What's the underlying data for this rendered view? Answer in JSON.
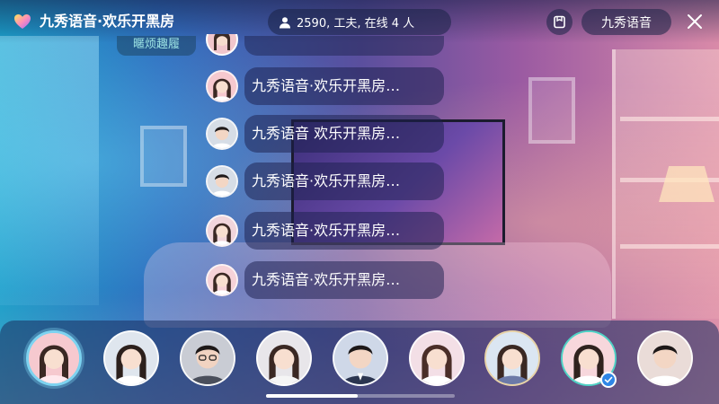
{
  "header": {
    "room_title": "九秀语音·欢乐开黑房",
    "online_text": "2590, 工夫, 在线 4 人",
    "brand_label": "九秀语音",
    "icons": {
      "room": "heart-gradient-icon",
      "user": "user-icon",
      "square": "square-rotate-icon",
      "close": "close-icon"
    }
  },
  "chat": {
    "partial_top_label": "暱烦趣履",
    "messages": [
      {
        "text": "九秀语音·欢乐开黑房…",
        "avatar_kind": "female"
      },
      {
        "text": "九秀语音 欢乐开黑房…",
        "avatar_kind": "male"
      },
      {
        "text": "九秀语音·欢乐开黑房…",
        "avatar_kind": "male"
      },
      {
        "text": "九秀语音·欢乐开黑房…",
        "avatar_kind": "female"
      },
      {
        "text": "九秀语音·欢乐开黑房…",
        "avatar_kind": "female"
      }
    ]
  },
  "seats": [
    {
      "avatar_kind": "female",
      "style": "active",
      "bg": "#f6c9cf"
    },
    {
      "avatar_kind": "female",
      "style": "plain",
      "bg": "#dfe6ee"
    },
    {
      "avatar_kind": "male-glasses",
      "style": "plain",
      "bg": "#c9ccd4"
    },
    {
      "avatar_kind": "female",
      "style": "plain",
      "bg": "#e8e6ea"
    },
    {
      "avatar_kind": "male",
      "style": "plain",
      "bg": "#cfd8e8"
    },
    {
      "avatar_kind": "female",
      "style": "plain",
      "bg": "#f3dfe6"
    },
    {
      "avatar_kind": "female",
      "style": "gold",
      "bg": "#dbe6f2"
    },
    {
      "avatar_kind": "female",
      "style": "teal",
      "bg": "#f7d7dc",
      "verified": true
    },
    {
      "avatar_kind": "male",
      "style": "plain",
      "bg": "#eadcd8"
    }
  ],
  "colors": {
    "accent": "#7dd3f0",
    "verify": "#2f86e6",
    "chip_text": "#9fe6e6"
  }
}
